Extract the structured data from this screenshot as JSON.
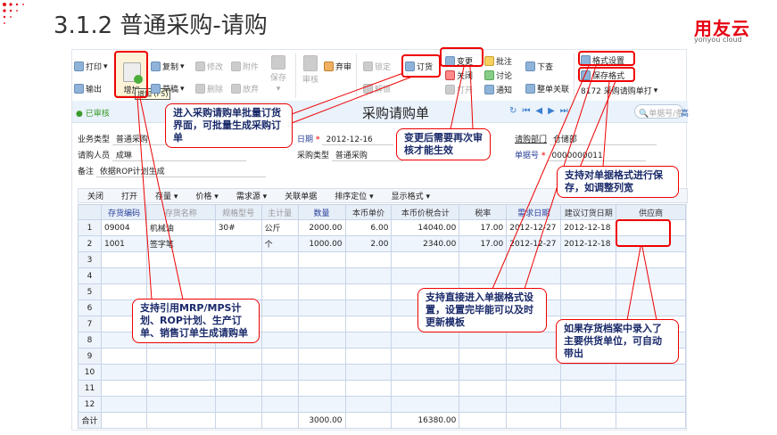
{
  "slide": {
    "title": "3.1.2 普通采购-请购",
    "logo": "用友云",
    "logo_sub": "yonyou cloud"
  },
  "toolbar": {
    "print": "打印",
    "export": "输出",
    "add": "增加",
    "add_tooltip": "增加 (F5)",
    "copy": "复制",
    "draft": "草稿",
    "modify": "修改",
    "delete": "删除",
    "attach": "附件",
    "discard": "放弃",
    "save": "保存",
    "audit": "审核",
    "abandon_audit": "弃审",
    "lock": "锁定",
    "unlock": "解锁",
    "order": "订货",
    "change": "变更",
    "close": "关闭",
    "open": "打开",
    "approve": "批注",
    "discuss": "讨论",
    "notify": "通知",
    "drilldown": "下查",
    "link": "整单关联",
    "format_setting": "格式设置",
    "save_format": "保存格式",
    "template": "8172 采购请购单打"
  },
  "header": {
    "status": "已审核",
    "doc_title": "采购请购单",
    "search_placeholder": "单据号/条码",
    "advanced": "高"
  },
  "form": {
    "biz_type_label": "业务类型",
    "biz_type": "普通采购",
    "requester_label": "请购人员",
    "requester": "成琳",
    "remark_label": "备注",
    "remark": "依据ROP计划生成",
    "date_label": "日期",
    "date": "2012-12-16",
    "purchase_type_label": "采购类型",
    "purchase_type": "普通采购",
    "dept_label": "请购部门",
    "dept": "仓储部",
    "docno_label": "单据号",
    "docno": "0000000011"
  },
  "grid_toolbar": [
    "关闭",
    "打开",
    "存量 ▾",
    "价格 ▾",
    "需求源 ▾",
    "关联单据",
    "排序定位 ▾",
    "显示格式 ▾"
  ],
  "columns": [
    "",
    "存货编码",
    "存货名称",
    "规格型号",
    "主计量",
    "数量",
    "本币单价",
    "本币价税合计",
    "税率",
    "需求日期",
    "建议订货日期",
    "供应商"
  ],
  "rows": [
    [
      "1",
      "09004",
      "机械油",
      "30#",
      "公斤",
      "2000.00",
      "6.00",
      "14040.00",
      "17.00",
      "2012-12-27",
      "2012-12-18",
      ""
    ],
    [
      "2",
      "1001",
      "签字笔",
      "",
      "个",
      "1000.00",
      "2.00",
      "2340.00",
      "17.00",
      "2012-12-27",
      "2012-12-18",
      ""
    ],
    [
      "3",
      "",
      "",
      "",
      "",
      "",
      "",
      "",
      "",
      "",
      "",
      ""
    ],
    [
      "4",
      "",
      "",
      "",
      "",
      "",
      "",
      "",
      "",
      "",
      "",
      ""
    ],
    [
      "5",
      "",
      "",
      "",
      "",
      "",
      "",
      "",
      "",
      "",
      "",
      ""
    ],
    [
      "6",
      "",
      "",
      "",
      "",
      "",
      "",
      "",
      "",
      "",
      "",
      ""
    ],
    [
      "7",
      "",
      "",
      "",
      "",
      "",
      "",
      "",
      "",
      "",
      "",
      ""
    ],
    [
      "8",
      "",
      "",
      "",
      "",
      "",
      "",
      "",
      "",
      "",
      "",
      ""
    ],
    [
      "9",
      "",
      "",
      "",
      "",
      "",
      "",
      "",
      "",
      "",
      "",
      ""
    ],
    [
      "10",
      "",
      "",
      "",
      "",
      "",
      "",
      "",
      "",
      "",
      "",
      ""
    ],
    [
      "11",
      "",
      "",
      "",
      "",
      "",
      "",
      "",
      "",
      "",
      "",
      ""
    ],
    [
      "12",
      "",
      "",
      "",
      "",
      "",
      "",
      "",
      "",
      "",
      "",
      ""
    ]
  ],
  "total": [
    "合计",
    "",
    "",
    "",
    "",
    "3000.00",
    "",
    "16380.00",
    "",
    "",
    "",
    ""
  ],
  "callouts": {
    "order": "进入采购请购单批量订货界面，可批量生成采购订单",
    "change": "变更后需要再次审核才能生效",
    "save_format": "支持对单据格式进行保存，如调整列宽",
    "source": "支持引用MRP/MPS计划、ROP计划、生产订单、销售订单生成请购单",
    "format": "支持直接进入单据格式设置，设置完毕能可以及时更新模板",
    "supplier": "如果存货档案中录入了主要供货单位，可自动带出"
  }
}
